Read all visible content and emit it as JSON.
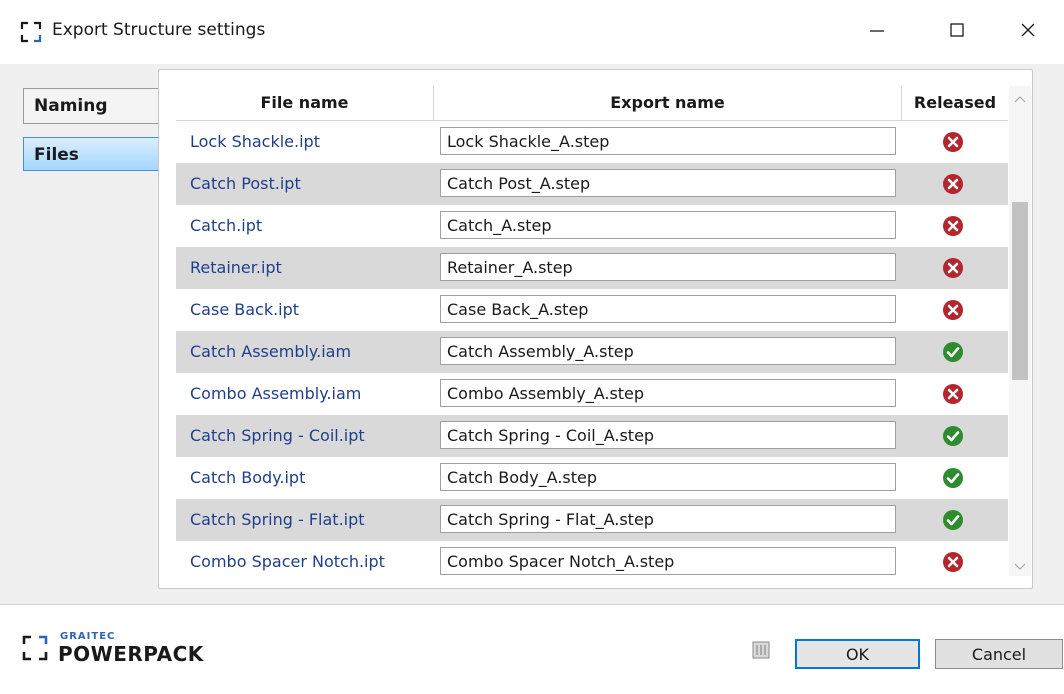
{
  "window": {
    "title": "Export Structure settings",
    "icons": {
      "app": "bracket-frame-icon",
      "minimize": "minimize-icon",
      "maximize": "maximize-icon",
      "close": "close-icon"
    }
  },
  "tabs": [
    {
      "label": "Naming",
      "selected": false
    },
    {
      "label": "Files",
      "selected": true
    }
  ],
  "grid": {
    "columns": [
      "File name",
      "Export name",
      "Released"
    ],
    "rows": [
      {
        "file_name": "Lock Shackle.ipt",
        "export_name": "Lock Shackle_A.step",
        "released": false
      },
      {
        "file_name": "Catch Post.ipt",
        "export_name": "Catch Post_A.step",
        "released": false
      },
      {
        "file_name": "Catch.ipt",
        "export_name": "Catch_A.step",
        "released": false
      },
      {
        "file_name": "Retainer.ipt",
        "export_name": "Retainer_A.step",
        "released": false
      },
      {
        "file_name": "Case Back.ipt",
        "export_name": "Case Back_A.step",
        "released": false
      },
      {
        "file_name": "Catch Assembly.iam",
        "export_name": "Catch Assembly_A.step",
        "released": true
      },
      {
        "file_name": "Combo Assembly.iam",
        "export_name": "Combo Assembly_A.step",
        "released": false
      },
      {
        "file_name": "Catch Spring - Coil.ipt",
        "export_name": "Catch Spring - Coil_A.step",
        "released": true
      },
      {
        "file_name": "Catch Body.ipt",
        "export_name": "Catch Body_A.step",
        "released": true
      },
      {
        "file_name": "Catch Spring - Flat.ipt",
        "export_name": "Catch Spring - Flat_A.step",
        "released": true
      },
      {
        "file_name": "Combo Spacer Notch.ipt",
        "export_name": "Combo Spacer Notch_A.step",
        "released": false
      }
    ],
    "scroll_position": 0.35,
    "scroll_visible_fraction": 0.4
  },
  "footer": {
    "logo_small": "GRAITEC",
    "logo_big": "POWERPACK",
    "help_icon": "help-book-icon",
    "ok_label": "OK",
    "cancel_label": "Cancel"
  },
  "colors": {
    "released_yes": "#2e8b2e",
    "released_no": "#b3262e",
    "alt_row": "#d9d9d9",
    "link_text": "#1f3f8c",
    "accent": "#0078d7"
  }
}
